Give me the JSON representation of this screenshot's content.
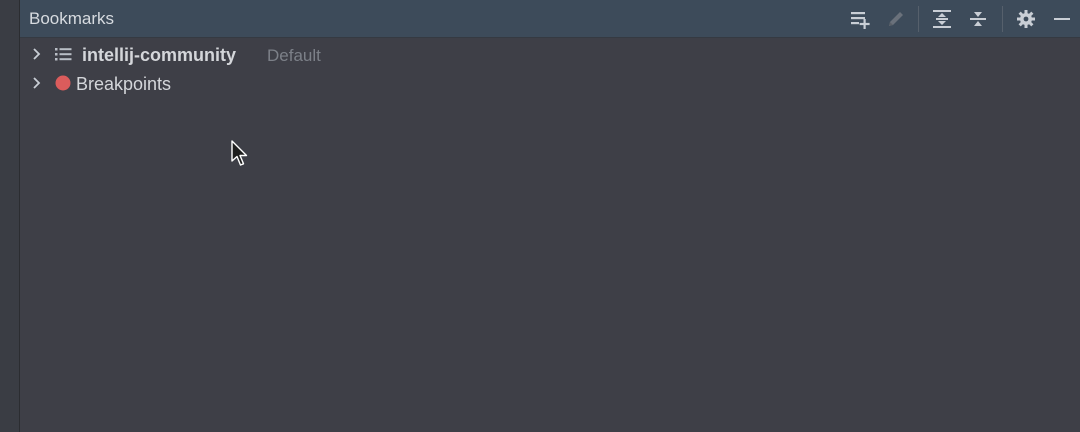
{
  "panel": {
    "title": "Bookmarks"
  },
  "toolbar": {
    "icons": [
      "add-list-icon",
      "pencil-icon",
      "expand-all-icon",
      "collapse-all-icon",
      "gear-icon",
      "minimize-icon"
    ]
  },
  "tree": {
    "items": [
      {
        "label": "intellij-community",
        "hint": "Default",
        "icon": "list-icon"
      },
      {
        "label": "Breakpoints",
        "icon": "breakpoint-dot-icon"
      }
    ]
  },
  "colors": {
    "header_bg": "#3d4b5a",
    "panel_bg": "#3e3f47",
    "breakpoint_red": "#db5c5c",
    "text": "#d4d6da",
    "hint": "#7c8088"
  }
}
